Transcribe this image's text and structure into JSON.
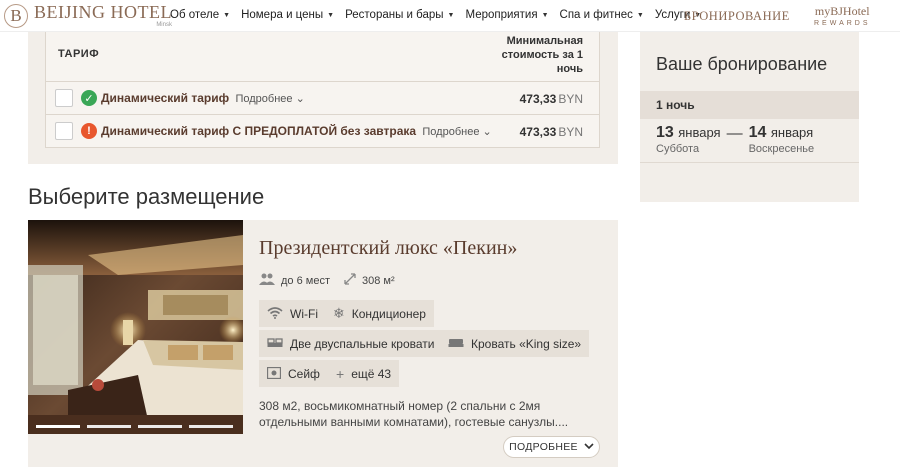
{
  "header": {
    "logo_letter": "B",
    "logo_title": "BEIJING HOTEL",
    "logo_sub": "Minsk",
    "nav": [
      {
        "label": "Об отеле"
      },
      {
        "label": "Номера и цены"
      },
      {
        "label": "Рестораны и бары"
      },
      {
        "label": "Мероприятия"
      },
      {
        "label": "Спа и фитнес"
      },
      {
        "label": "Услуги"
      }
    ],
    "booking_link": "БРОНИРОВАНИЕ",
    "rewards_top": "myBJHotel",
    "rewards_bottom": "REWARDS"
  },
  "tariffs": {
    "header_tariff": "ТАРИФ",
    "header_min_cost": "Минимальная стоимость за 1 ночь",
    "rows": [
      {
        "name": "Динамический тариф",
        "more": "Подробнее",
        "price": "473,33",
        "currency": "BYN",
        "status": "ok"
      },
      {
        "name": "Динамический тариф С ПРЕДОПЛАТОЙ без завтрака",
        "more": "Подробнее",
        "price": "473,33",
        "currency": "BYN",
        "status": "warn"
      }
    ]
  },
  "section": {
    "title": "Выберите размещение"
  },
  "room": {
    "title": "Президентский люкс «Пекин»",
    "guests": "до 6 мест",
    "area": "308 м²",
    "amenities": [
      "Wi-Fi",
      "Кондиционер",
      "Две двуспальные кровати",
      "Кровать «King size»",
      "Сейф",
      "ещё 43"
    ],
    "description": "308 м2, восьмикомнатный номер (2 спальни с 2мя отдельными ванными комнатами), гостевые санузлы....",
    "more_button": "ПОДРОБНЕЕ"
  },
  "summary": {
    "title": "Ваше бронирование",
    "nights": "1 ночь",
    "checkin_day": "13",
    "checkin_month": "января",
    "checkin_weekday": "Суббота",
    "checkout_day": "14",
    "checkout_month": "января",
    "checkout_weekday": "Воскресенье"
  },
  "colors": {
    "brand": "#8a6a55",
    "panel": "#f2eee9",
    "ok": "#3aa757",
    "warn": "#e8572e"
  }
}
